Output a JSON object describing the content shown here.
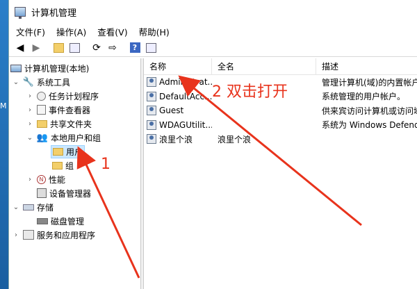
{
  "window": {
    "title": "计算机管理"
  },
  "menu": [
    "文件(F)",
    "操作(A)",
    "查看(V)",
    "帮助(H)"
  ],
  "tree": {
    "root": "计算机管理(本地)",
    "system_tools": "系统工具",
    "task_scheduler": "任务计划程序",
    "event_viewer": "事件查看器",
    "shared_folders": "共享文件夹",
    "local_users_groups": "本地用户和组",
    "users": "用户",
    "groups": "组",
    "performance": "性能",
    "device_manager": "设备管理器",
    "storage": "存储",
    "disk_management": "磁盘管理",
    "services_apps": "服务和应用程序"
  },
  "columns": {
    "name": "名称",
    "full_name": "全名",
    "description": "描述"
  },
  "users": [
    {
      "name": "Administrat...",
      "full_name": "",
      "description": "管理计算机(域)的内置帐户"
    },
    {
      "name": "DefaultAcc...",
      "full_name": "",
      "description": "系统管理的用户帐户。"
    },
    {
      "name": "Guest",
      "full_name": "",
      "description": "供来宾访问计算机或访问域"
    },
    {
      "name": "WDAGUtilit...",
      "full_name": "",
      "description": "系统为 Windows Defend"
    },
    {
      "name": "浪里个浪",
      "full_name": "浪里个浪",
      "description": ""
    }
  ],
  "annotations": {
    "step1": "1",
    "step2": "2  双击打开",
    "color": "#e8331c"
  },
  "desktop_edge_text": "M"
}
